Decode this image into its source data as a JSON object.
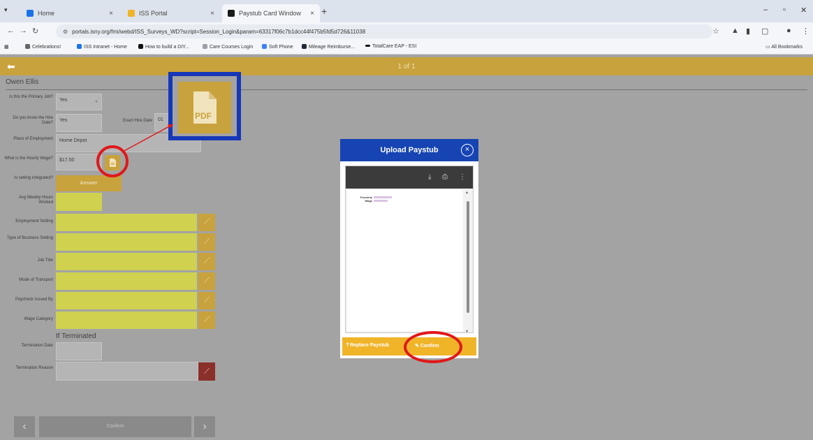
{
  "browser": {
    "tabs": [
      {
        "label": "Home",
        "color": "#1a73e8"
      },
      {
        "label": "ISS Portal",
        "color": "#f0b429"
      },
      {
        "label": "Paystub Card Window",
        "color": "#1a1a1a"
      }
    ],
    "tab_close": "×",
    "new_tab": "+",
    "url": "portals.isny.org/fmi/webd/ISS_Surveys_WD?script=Session_Login&param=63317f06c7b1dcc44f475b5fd5d726&11038",
    "bookmarks": [
      {
        "label": "Celebrations!",
        "color": "#666666"
      },
      {
        "label": "ISS Intranet - Home",
        "color": "#1a73e8"
      },
      {
        "label": "How to build a DIY...",
        "color": "#111111"
      },
      {
        "label": "Care Courses Login",
        "color": "#9aa0a6"
      },
      {
        "label": "Soft Phone",
        "color": "#3b82f6"
      },
      {
        "label": "Mileage Reimburse...",
        "color": "#1f2937"
      },
      {
        "label": "TotalCare EAP - ESI",
        "color": "#111111"
      }
    ],
    "all_bookmarks": "All Bookmarks"
  },
  "header": {
    "pager": "1 of 1",
    "back_icon": "arrow-left-icon"
  },
  "person": "Owen Ellis",
  "form": {
    "primary_job_label": "Is this the Primary Job?",
    "primary_job_value": "Yes",
    "know_hire_label": "Do you know the Hire Date?",
    "know_hire_value": "Yes",
    "exact_hire_label": "Exact Hire Date",
    "exact_hire_value": "01",
    "place_label": "Place of Employment",
    "place_value": "Home Depot",
    "wage_label": "What is the Hourly Wage?",
    "wage_value": "$17.50",
    "integrated_label": "Is setting integrated?",
    "answer_btn": "Answer",
    "avg_hours_label": "Avg Weekly Hours Worked",
    "yellow_rows": [
      "Employment Setting",
      "Type of Business Setting",
      "Job Title",
      "Mode of Transport",
      "Paycheck Issued By",
      "Wage Category"
    ],
    "if_terminated": "If Terminated",
    "termination_date_label": "Termination Date",
    "termination_reason_label": "Termination Reason",
    "edit_glyph": "⟋"
  },
  "footer": {
    "prev": "‹",
    "confirm": "Confirm",
    "next": "›"
  },
  "callout": {
    "pdf_label": "PDF"
  },
  "modal": {
    "title": "Upload Paystub",
    "close": "×",
    "viewer_icons": [
      "download-icon",
      "print-icon",
      "more-icon"
    ],
    "page_text": "Formerly Wage",
    "replace_btn": "Replace Paystub",
    "confirm_btn": "Confirm"
  },
  "colors": {
    "gold": "#c8a23c",
    "blue": "#1644b3",
    "highlight_red": "#e0181a",
    "yellow_field": "#cfd14f",
    "footer_orange": "#f0b429"
  }
}
